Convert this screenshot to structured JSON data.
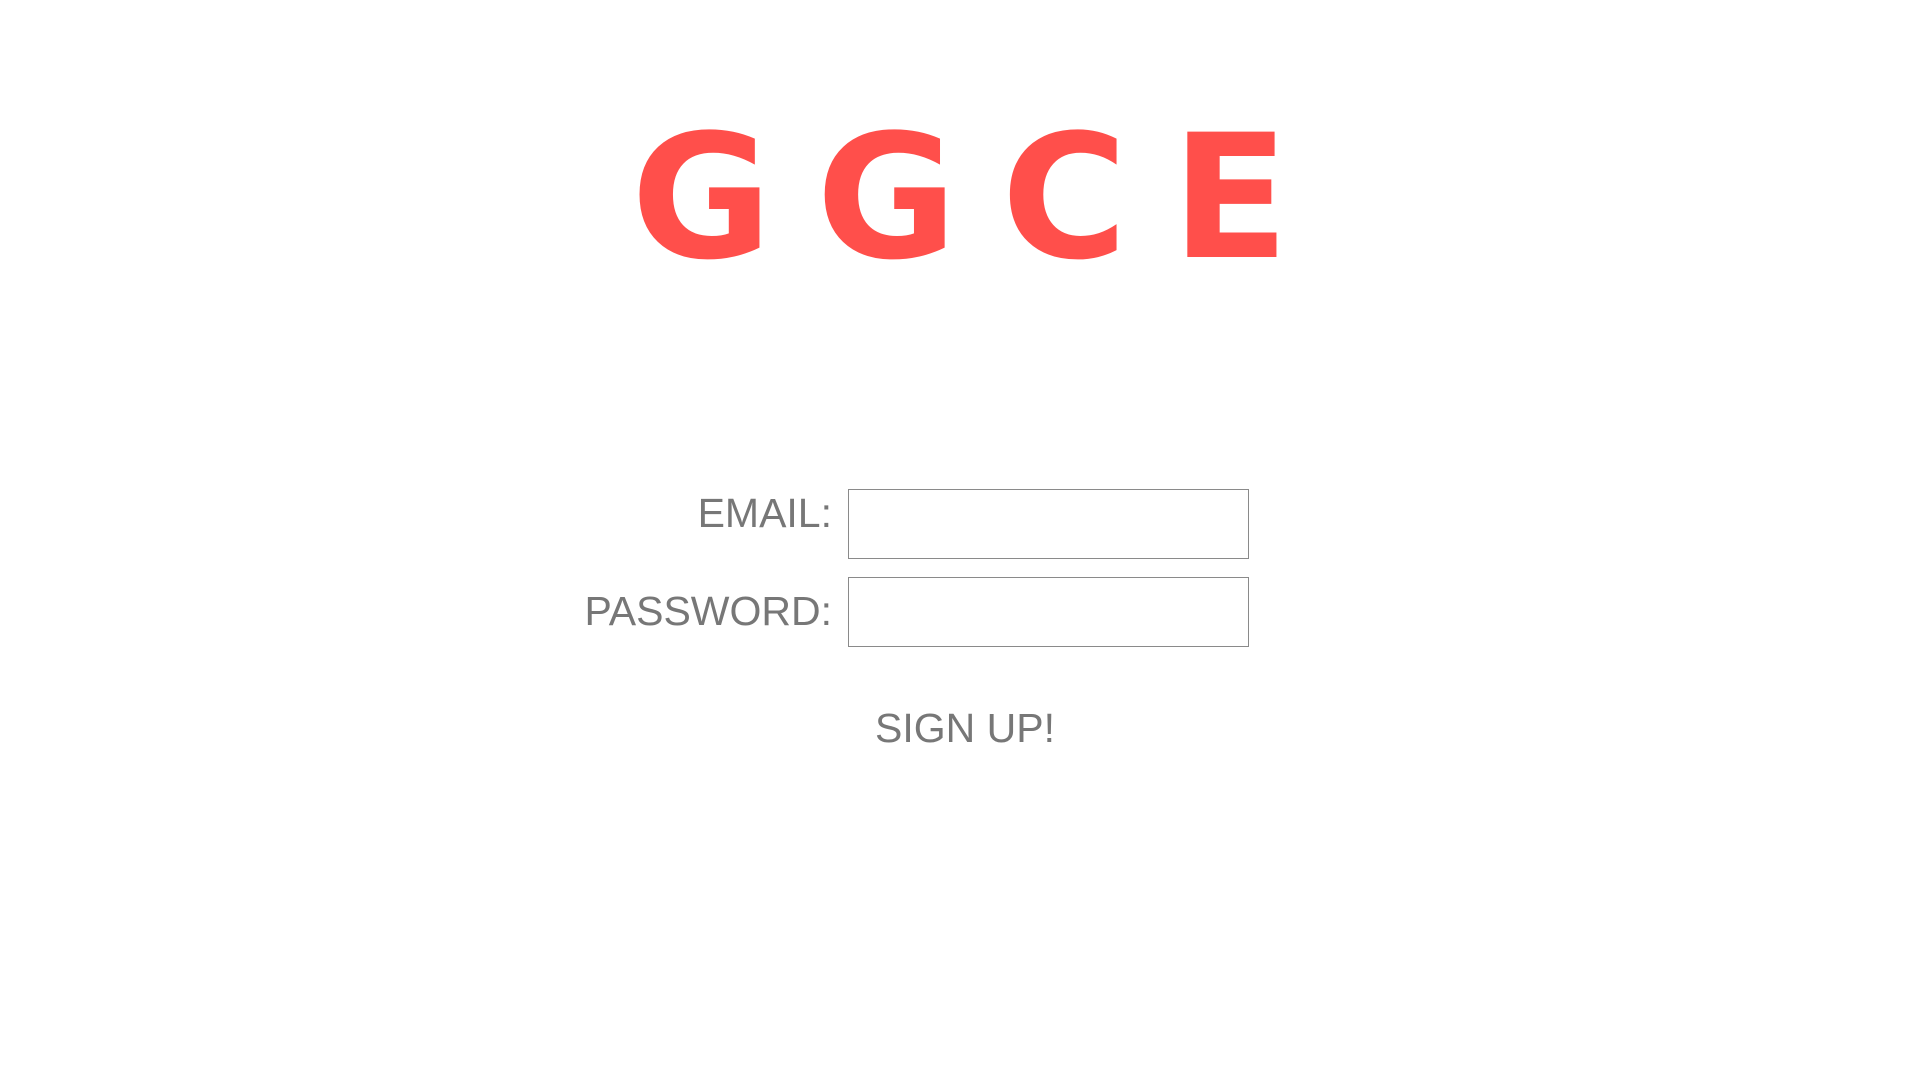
{
  "logo": {
    "text": "GGCE",
    "color": "#ff4f4b"
  },
  "form": {
    "email_label": "EMAIL:",
    "email_value": "",
    "password_label": "PASSWORD:",
    "password_value": "",
    "submit_label": "SIGN UP!"
  },
  "colors": {
    "label_text": "#777777",
    "input_border": "#8a8a8a",
    "background": "#ffffff"
  }
}
